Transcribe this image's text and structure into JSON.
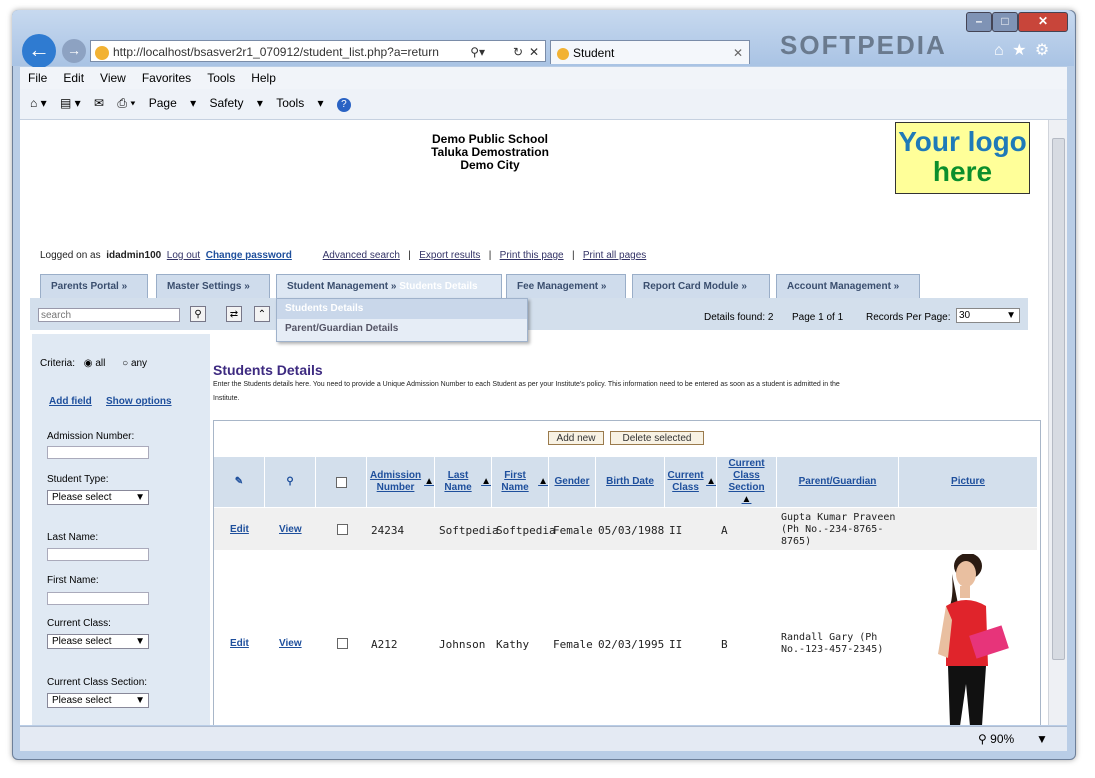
{
  "browser": {
    "url": "http://localhost/bsasver2r1_070912/student_list.php?a=return",
    "url_host": "localhost",
    "tab_title": "Student",
    "watermark": "SOFTPEDIA",
    "menu": [
      "File",
      "Edit",
      "View",
      "Favorites",
      "Tools",
      "Help"
    ],
    "commands": [
      "Page",
      "Safety",
      "Tools"
    ],
    "zoom": "90%"
  },
  "school": {
    "name": "Demo Public School",
    "line2": "Taluka Demostration",
    "line3": "Demo City",
    "logo_line1": "Your logo",
    "logo_line2": "here"
  },
  "toplinks": {
    "logged_on": "Logged on as",
    "user": "idadmin100",
    "logout": "Log out",
    "change_password": "Change password",
    "advanced_search": "Advanced search",
    "export_results": "Export results",
    "print_page": "Print this page",
    "print_all": "Print all pages",
    "sep": "|"
  },
  "tabs": [
    "Parents Portal",
    "Master Settings",
    "Student Management",
    "Students Details",
    "Fee Management",
    "Report Card Module",
    "Account Management"
  ],
  "dropdown": [
    "Students Details",
    "Parent/Guardian Details"
  ],
  "searchbar": {
    "placeholder": "search",
    "details_found": "Details found: 2",
    "page_info": "Page 1 of 1",
    "records_label": "Records Per Page:",
    "records_value": "30"
  },
  "sidebar": {
    "criteria": "Criteria:",
    "all": "all",
    "any": "any",
    "add_field": "Add field",
    "show_options": "Show options",
    "admission_number": "Admission Number:",
    "student_type": "Student Type:",
    "last_name": "Last Name:",
    "first_name": "First Name:",
    "current_class": "Current Class:",
    "current_class_section": "Current Class Section:",
    "please_select": "Please select"
  },
  "main": {
    "heading": "Students Details",
    "description": "Enter the Students details here. You need to provide a Unique Admission Number to each Student as per your Institute's policy. This information need to be entered as soon as a student is admitted in the Institute.",
    "add_new": "Add new",
    "delete_selected": "Delete selected"
  },
  "table": {
    "headers": {
      "admission": "Admission Number",
      "last": "Last Name",
      "first": "First Name",
      "gender": "Gender",
      "birth": "Birth Date",
      "class": "Current Class",
      "section": "Current Class Section",
      "parent": "Parent/Guardian",
      "picture": "Picture"
    },
    "edit": "Edit",
    "view": "View",
    "rows": [
      {
        "admission": "24234",
        "last": "Softpedia",
        "first": "Softpedia",
        "gender": "Female",
        "birth": "05/03/1988",
        "class": "II",
        "section": "A",
        "parent": "Gupta Kumar Praveen (Ph No.-234-8765-8765)"
      },
      {
        "admission": "A212",
        "last": "Johnson",
        "first": "Kathy",
        "gender": "Female",
        "birth": "02/03/1995",
        "class": "II",
        "section": "B",
        "parent": "Randall Gary (Ph No.-123-457-2345)"
      }
    ]
  }
}
